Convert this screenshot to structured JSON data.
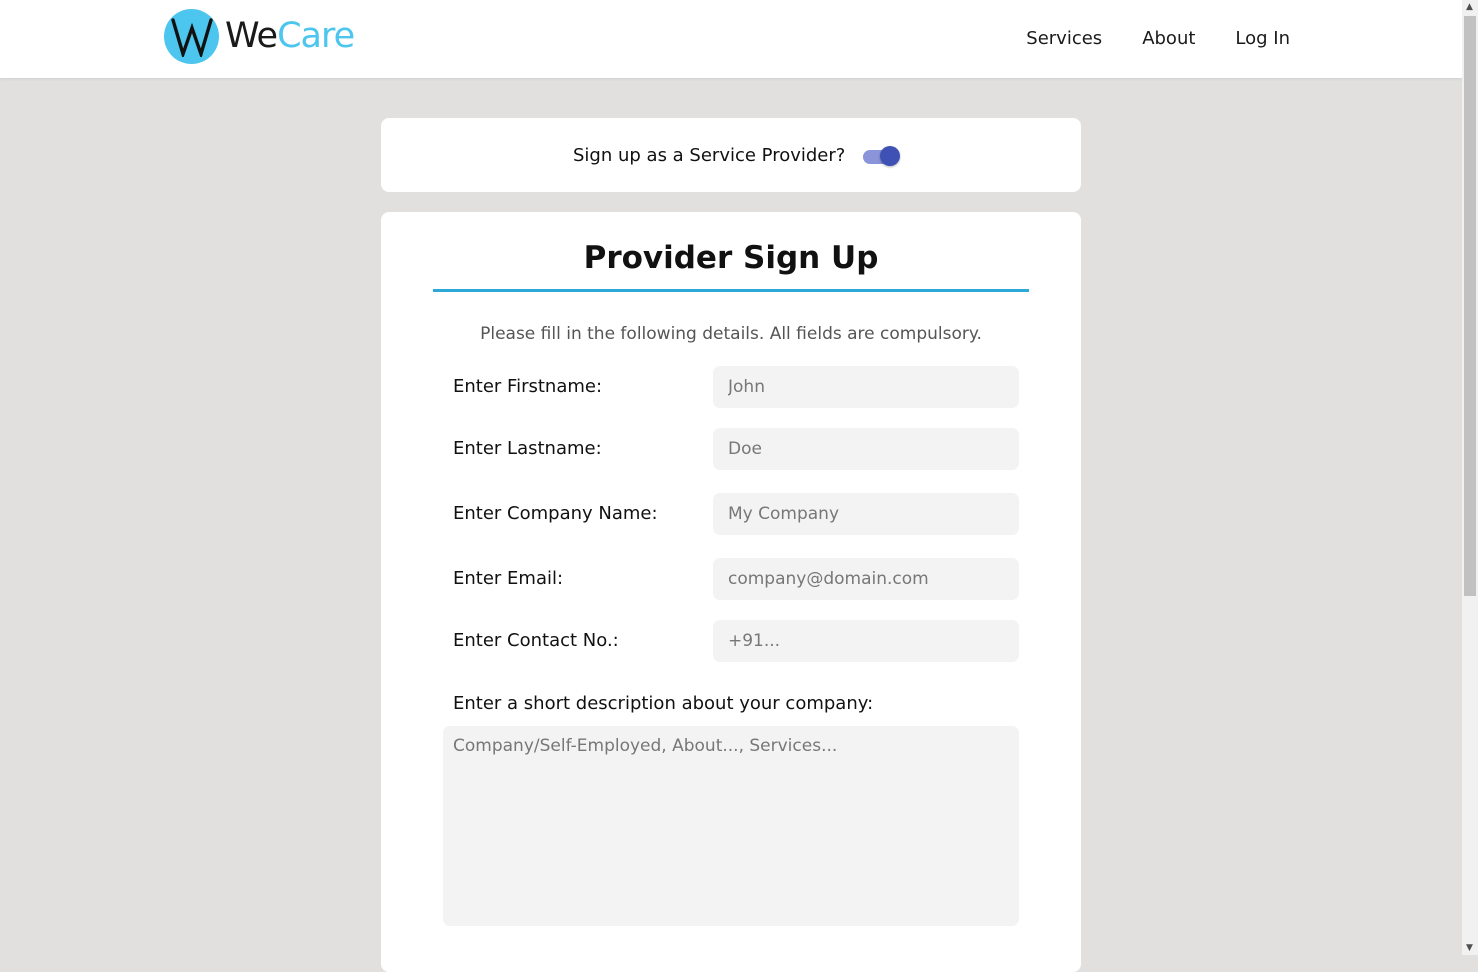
{
  "brand": {
    "name_part1": "We",
    "name_part2": "Care",
    "logo_letter": "W",
    "accent_color": "#4cc6ee"
  },
  "nav": {
    "links": [
      "Services",
      "About",
      "Log In"
    ]
  },
  "provider_toggle": {
    "label": "Sign up as a Service Provider?",
    "checked": true
  },
  "form": {
    "title": "Provider Sign Up",
    "note": "Please fill in the following details. All fields are compulsory.",
    "fields": [
      {
        "label": "Enter Firstname:",
        "placeholder": "John"
      },
      {
        "label": "Enter Lastname:",
        "placeholder": "Doe"
      },
      {
        "label": "Enter Company Name:",
        "placeholder": "My Company"
      },
      {
        "label": "Enter Email:",
        "placeholder": "company@domain.com"
      },
      {
        "label": "Enter Contact No.:",
        "placeholder": "+91..."
      }
    ],
    "description": {
      "label": "Enter a short description about your company:",
      "placeholder": "Company/Self-Employed, About..., Services..."
    }
  }
}
